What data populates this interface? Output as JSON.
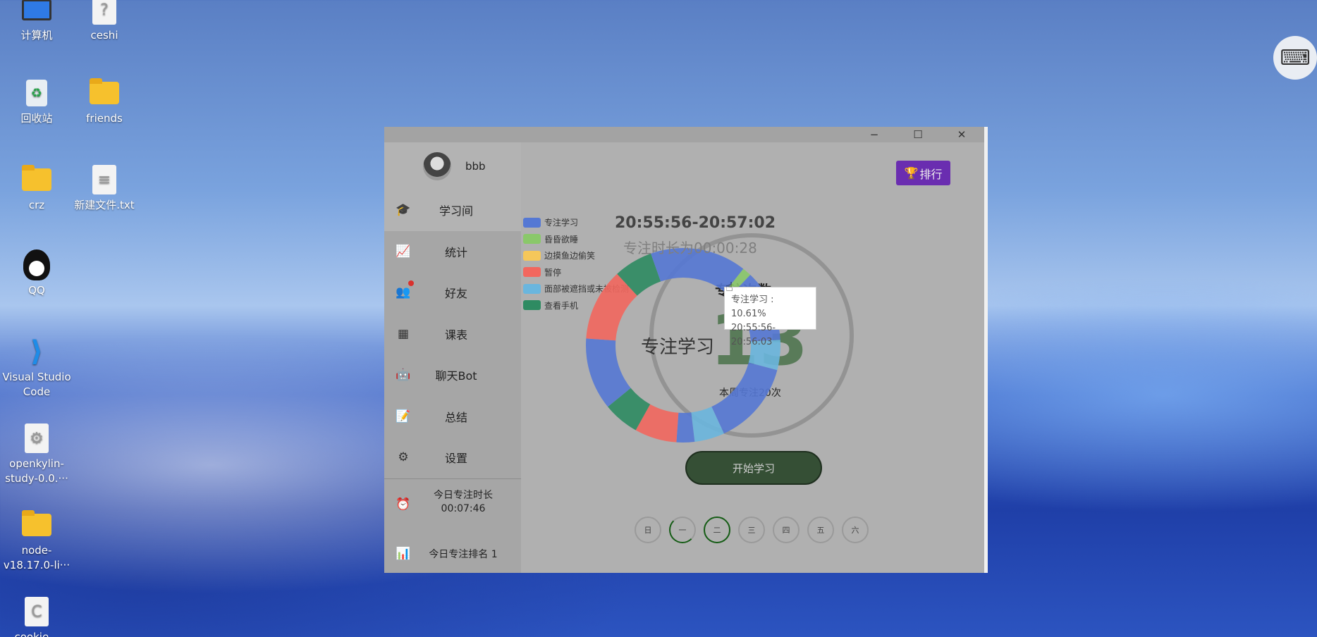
{
  "desktop": {
    "icons": [
      {
        "label": "计算机"
      },
      {
        "label": "ceshi"
      },
      {
        "label": "回收站"
      },
      {
        "label": "friends"
      },
      {
        "label": "crz"
      },
      {
        "label": "新建文件.txt"
      },
      {
        "label": "QQ"
      },
      {
        "label": "Visual Studio Code"
      },
      {
        "label": "openkylin-study-0.0.···"
      },
      {
        "label": "node-v18.17.0-li···"
      },
      {
        "label": "cookie..."
      }
    ]
  },
  "window": {
    "minimize": "−",
    "maximize": "☐",
    "close": "✕"
  },
  "sidebar": {
    "username": "bbb",
    "items": [
      {
        "label": "学习间",
        "icon": "graduation-cap-icon"
      },
      {
        "label": "统计",
        "icon": "chart-icon"
      },
      {
        "label": "好友",
        "icon": "users-icon"
      },
      {
        "label": "课表",
        "icon": "timetable-icon"
      },
      {
        "label": "聊天Bot",
        "icon": "robot-icon"
      },
      {
        "label": "总结",
        "icon": "calendar-edit-icon"
      },
      {
        "label": "设置",
        "icon": "gear-icon"
      }
    ],
    "today_focus_label": "今日专注时长",
    "today_focus_value": "00:07:46",
    "today_rank_label": "今日专注排名 1"
  },
  "main": {
    "rank_button": "排行",
    "time_range": "20:55:56-20:57:02",
    "duration": "专注时长为00:00:28",
    "focus_count_title": "专注次数",
    "big_number": "13",
    "week_count": "本周专注20次",
    "donut_center": "专注学习",
    "tooltip": {
      "line1": "专注学习 : 10.61%",
      "line2": "20:55:56-20:56:03"
    },
    "start_button": "开始学习",
    "days": [
      "日",
      "一",
      "二",
      "三",
      "四",
      "五",
      "六"
    ]
  },
  "chart_data": {
    "type": "pie",
    "legend": [
      {
        "name": "专注学习",
        "color": "#5578d4"
      },
      {
        "name": "昏昏欲睡",
        "color": "#8ac86a"
      },
      {
        "name": "边摸鱼边偷笑",
        "color": "#f5c75a"
      },
      {
        "name": "暂停",
        "color": "#f2675e"
      },
      {
        "name": "面部被遮挡或未被检测",
        "color": "#6ab6de"
      },
      {
        "name": "查看手机",
        "color": "#2e8b62"
      }
    ],
    "segments": [
      {
        "name": "专注学习",
        "value": 10.61
      },
      {
        "name": "昏昏欲睡",
        "value": 1.5
      },
      {
        "name": "专注学习",
        "value": 12
      },
      {
        "name": "面部被遮挡或未被检测",
        "value": 5
      },
      {
        "name": "专注学习",
        "value": 14
      },
      {
        "name": "面部被遮挡或未被检测",
        "value": 5
      },
      {
        "name": "专注学习",
        "value": 3
      },
      {
        "name": "暂停",
        "value": 7
      },
      {
        "name": "查看手机",
        "value": 6
      },
      {
        "name": "专注学习",
        "value": 12
      },
      {
        "name": "暂停",
        "value": 12
      },
      {
        "name": "查看手机",
        "value": 6.5
      },
      {
        "name": "专注学习",
        "value": 5.39
      }
    ]
  }
}
